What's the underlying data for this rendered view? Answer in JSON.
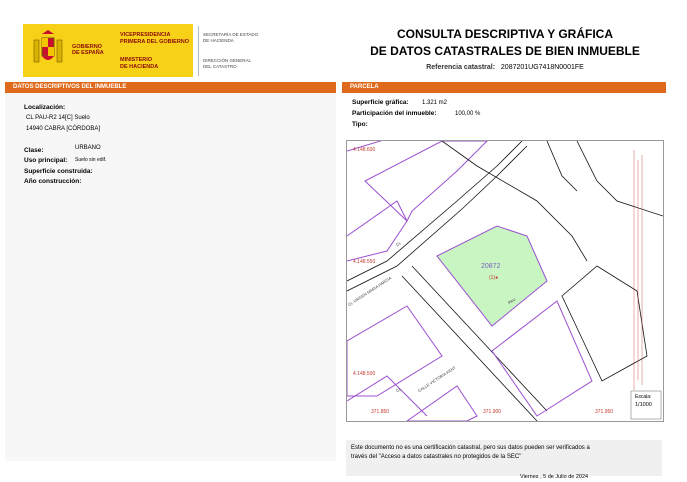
{
  "header": {
    "gobierno": [
      "GOBIERNO",
      "DE ESPAÑA"
    ],
    "vicepresidencia": [
      "VICEPRESIDENCIA",
      "PRIMERA DEL GOBIERNO"
    ],
    "ministerio": [
      "MINISTERIO",
      "DE HACIENDA"
    ],
    "secretaria": [
      "SECRETARÍA DE ESTADO",
      "DE HACIENDA"
    ],
    "direccion": [
      "DIRECCIÓN GENERAL",
      "DEL CATASTRO"
    ],
    "title_line1": "CONSULTA DESCRIPTIVA Y GRÁFICA",
    "title_line2": "DE DATOS CATASTRALES DE BIEN INMUEBLE",
    "ref_label": "Referencia catastral:",
    "ref_value": "2087201UG7418N0001FE"
  },
  "left": {
    "section_title": "DATOS DESCRIPTIVOS DEL INMUEBLE",
    "localizacion_label": "Localización:",
    "localizacion_line1": "CL PAU-R2 14[C] Suelo",
    "localizacion_line2": "14940 CABRA [CÓRDOBA]",
    "clase_label": "Clase:",
    "clase_value": "URBANO",
    "uso_label": "Uso principal:",
    "uso_value": "Suelo sin edif.",
    "superficie_construida_label": "Superficie construida:",
    "anio_label": "Año construcción:"
  },
  "right": {
    "section_title": "PARCELA",
    "superficie_grafica_label": "Superficie gráfica:",
    "superficie_grafica_value": "1.321 m2",
    "participacion_label": "Participación del inmueble:",
    "participacion_value": "100,00 %",
    "tipo_label": "Tipo:"
  },
  "map": {
    "coord_y1": "4.148.600",
    "coord_y2": "4.148.550",
    "coord_y3": "4.148.500",
    "coord_x1": "371.850",
    "coord_x2": "371.900",
    "coord_x3": "371.950",
    "parcel_number": "20872",
    "street1": "CL VIRGEN MARIA PARCIA",
    "street2": "CALLE VICTORIA KENT",
    "street3": "PAU",
    "street4": "CL",
    "street5": "CL",
    "scale_label": "Escala:",
    "scale_value": "1/1000",
    "colors": {
      "parcel_fill": "#c9f5c3",
      "lines": "#9b4fd0"
    }
  },
  "footer": {
    "notice_line1": "Este documento no es una certificación catastral, pero sus datos pueden ser verificados a",
    "notice_line2": "través del \"Acceso a datos catastrales no protegidos de la SEC\"",
    "date": "Viernes , 5 de Julio de 2024"
  }
}
